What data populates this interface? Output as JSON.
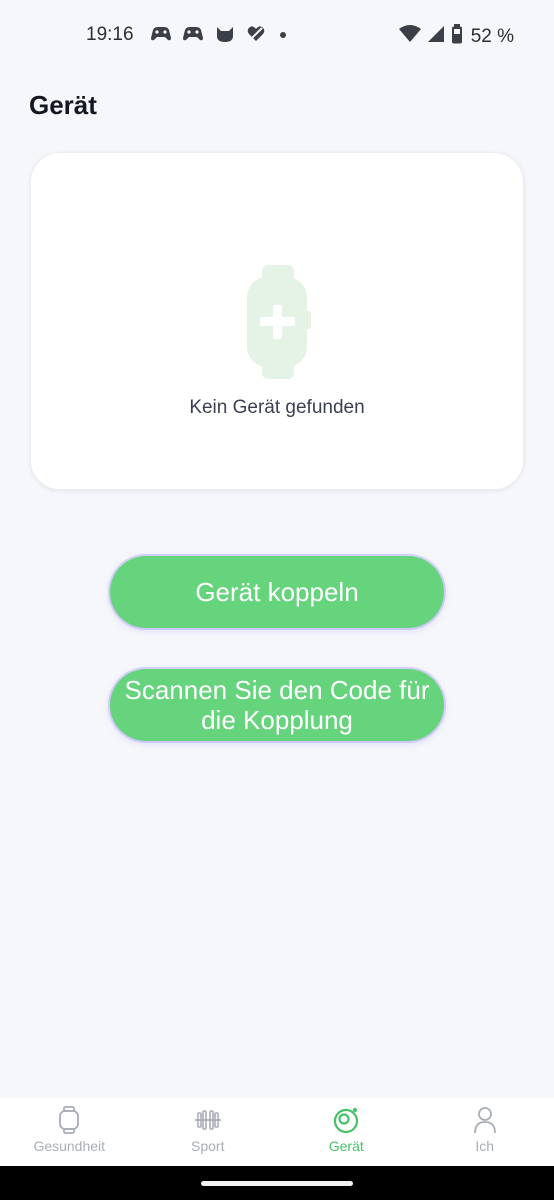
{
  "status_bar": {
    "time": "19:16",
    "battery_text": "52 %",
    "notification_icons": [
      "game-controller-icon",
      "game-controller-icon",
      "cat-icon",
      "heart-slash-icon",
      "dot-icon"
    ]
  },
  "page": {
    "title": "Gerät"
  },
  "device_card": {
    "empty_text": "Kein Gerät gefunden",
    "icon": "watch-add-icon"
  },
  "buttons": {
    "pair_label": "Gerät koppeln",
    "scan_label": "Scannen Sie den Code für die Kopplung"
  },
  "bottom_nav": {
    "items": [
      {
        "label": "Gesundheit",
        "icon": "watch-icon",
        "active": false
      },
      {
        "label": "Sport",
        "icon": "dumbbell-icon",
        "active": false
      },
      {
        "label": "Gerät",
        "icon": "device-icon",
        "active": true
      },
      {
        "label": "Ich",
        "icon": "person-icon",
        "active": false
      }
    ]
  },
  "colors": {
    "accent_green": "#66d37d",
    "active_nav_green": "#45c167",
    "inactive_nav_gray": "#a9adb6",
    "watch_icon_green": "#e4f3e6",
    "background": "#f6f7fb"
  }
}
